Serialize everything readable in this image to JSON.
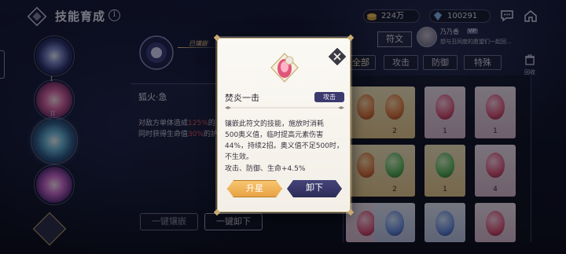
{
  "header": {
    "title": "技能育成",
    "info_icon_glyph": "i",
    "gold_amount": "224万",
    "gem_amount": "100291"
  },
  "left": {
    "node_labels": [
      "I",
      "II"
    ],
    "skill_name": "狐火·急",
    "skill_desc_line1_prefix": "对敌方单体造成",
    "skill_desc_line1_value": "125%",
    "skill_desc_line1_suffix": "的",
    "skill_desc_line2_prefix": "同时获得生命值",
    "skill_desc_line2_value": "30%",
    "skill_desc_line2_suffix": "的护",
    "equipped_tag": "已镶嵌",
    "btn_unequip_all_dim": "一键镶嵌",
    "btn_unequip_all": "一键卸下"
  },
  "right": {
    "rune_tab": "符文",
    "player_name": "乃乃香",
    "player_badge": "VIP",
    "player_msg": "想与丑同度的愿望们一起回...",
    "tabs": [
      "全部",
      "攻击",
      "防御",
      "特殊"
    ],
    "recycle_label": "回收",
    "slot_numbers": [
      "",
      "2",
      "1",
      "1",
      "",
      "2",
      "1",
      "4"
    ]
  },
  "modal": {
    "rune_name": "焚炎一击",
    "type_badge": "攻击",
    "description": "镶嵌此符文的技能，施放时消耗\n500奥义值，临时提高元素伤害\n44%，持续2招。奥义值不足500时，\n不生效。",
    "stats": "攻击、防御、生命+4.5%",
    "btn_upgrade": "升星",
    "btn_unequip": "卸下"
  },
  "colors": {
    "accent_gold": "#c8ac72",
    "badge_purple": "#3b3a6e",
    "highlight_red": "#e0505a"
  }
}
